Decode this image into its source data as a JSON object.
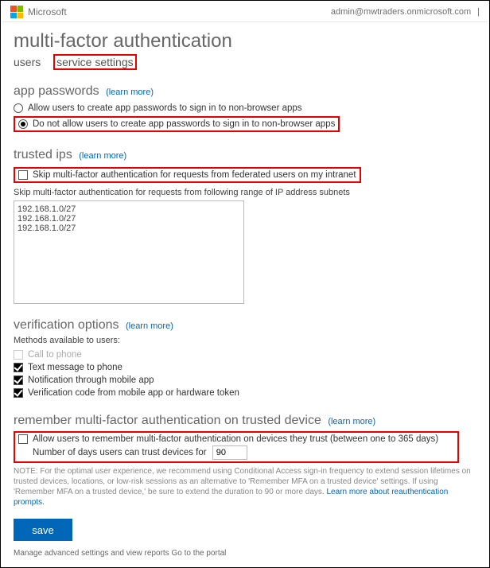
{
  "header": {
    "brand": "Microsoft",
    "user": "admin@mwtraders.onmicrosoft.com"
  },
  "page": {
    "title": "multi-factor authentication",
    "tab_users": "users",
    "tab_service_settings": "service settings"
  },
  "learn_more": "(learn more)",
  "app_passwords": {
    "title": "app passwords",
    "opt_allow": "Allow users to create app passwords to sign in to non-browser apps",
    "opt_disallow": "Do not allow users to create app passwords to sign in to non-browser apps"
  },
  "trusted_ips": {
    "title": "trusted ips",
    "opt_skip_federated": "Skip multi-factor authentication for requests from federated users on my intranet",
    "subnets_label": "Skip multi-factor authentication for requests from following range of IP address subnets",
    "subnets_value": "192.168.1.0/27\n192.168.1.0/27\n192.168.1.0/27"
  },
  "verification": {
    "title": "verification options",
    "methods_label": "Methods available to users:",
    "opt_call": "Call to phone",
    "opt_sms": "Text message to phone",
    "opt_app_notify": "Notification through mobile app",
    "opt_app_code": "Verification code from mobile app or hardware token"
  },
  "remember": {
    "title": "remember multi-factor authentication on trusted device",
    "opt_allow": "Allow users to remember multi-factor authentication on devices they trust (between one to 365 days)",
    "days_label": "Number of days users can trust devices for",
    "days_value": "90",
    "note_prefix": "NOTE: For the optimal user experience, we recommend using Conditional Access sign-in frequency to extend session lifetimes on trusted devices, locations, or low-risk sessions as an alternative to 'Remember MFA on a trusted device' settings. If using 'Remember MFA on a trusted device,' be sure to extend the duration to 90 or more days. ",
    "note_link": "Learn more about reauthentication prompts."
  },
  "save_label": "save",
  "bottom_cut": "Manage advanced settings and view reports Go to the portal"
}
